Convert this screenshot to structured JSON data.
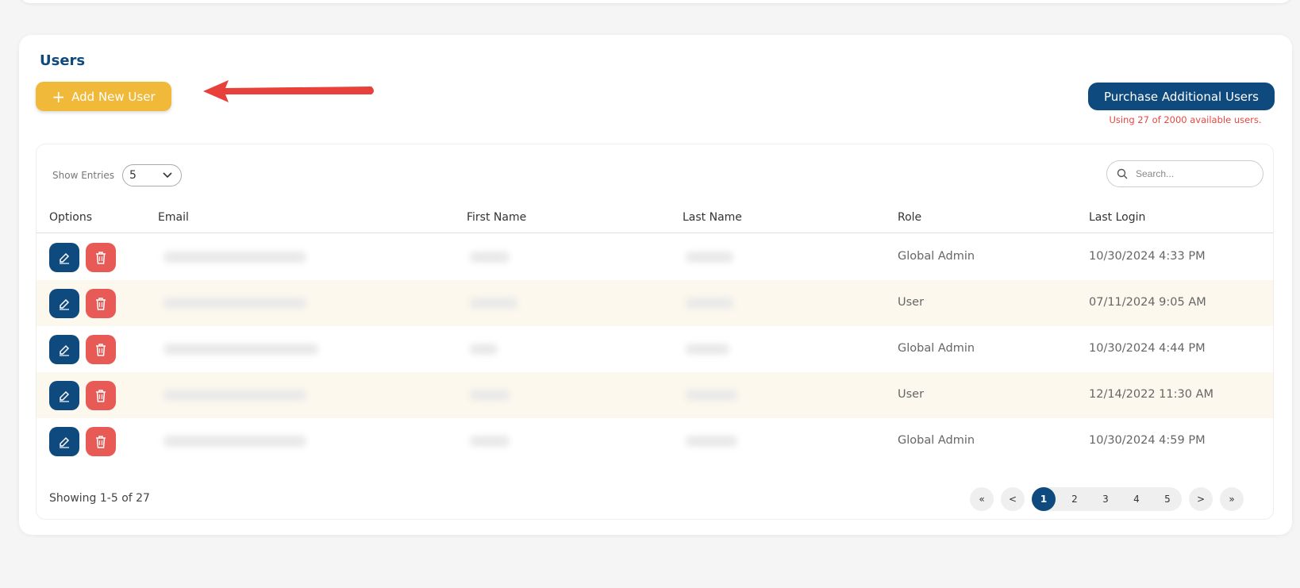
{
  "page": {
    "title": "Users",
    "add_button_label": "Add New User",
    "purchase_button_label": "Purchase Additional Users",
    "usage_text": "Using 27 of 2000 available users."
  },
  "table": {
    "show_entries_label": "Show Entries",
    "entries_value": "5",
    "search_placeholder": "Search...",
    "columns": [
      "Options",
      "Email",
      "First Name",
      "Last Name",
      "Role",
      "Last Login"
    ],
    "rows": [
      {
        "role": "Global Admin",
        "last_login": "10/30/2024 4:33 PM"
      },
      {
        "role": "User",
        "last_login": "07/11/2024 9:05 AM"
      },
      {
        "role": "Global Admin",
        "last_login": "10/30/2024 4:44 PM"
      },
      {
        "role": "User",
        "last_login": "12/14/2022 11:30 AM"
      },
      {
        "role": "Global Admin",
        "last_login": "10/30/2024 4:59 PM"
      }
    ],
    "showing_text": "Showing 1-5 of 27"
  },
  "pagination": {
    "first": "«",
    "prev": "<",
    "pages": [
      "1",
      "2",
      "3",
      "4",
      "5"
    ],
    "active_page": "1",
    "next": ">",
    "last": "»"
  },
  "colors": {
    "primary": "#0e4a7d",
    "accent": "#f0b93a",
    "danger": "#e85a56",
    "alert_text": "#e8473f",
    "annotation_arrow": "#e8403a"
  },
  "icons": {
    "add": "plus-icon",
    "edit": "edit-icon",
    "delete": "trash-icon",
    "search": "search-icon",
    "dropdown": "chevron-down-icon",
    "annotation": "red-arrow-icon"
  }
}
